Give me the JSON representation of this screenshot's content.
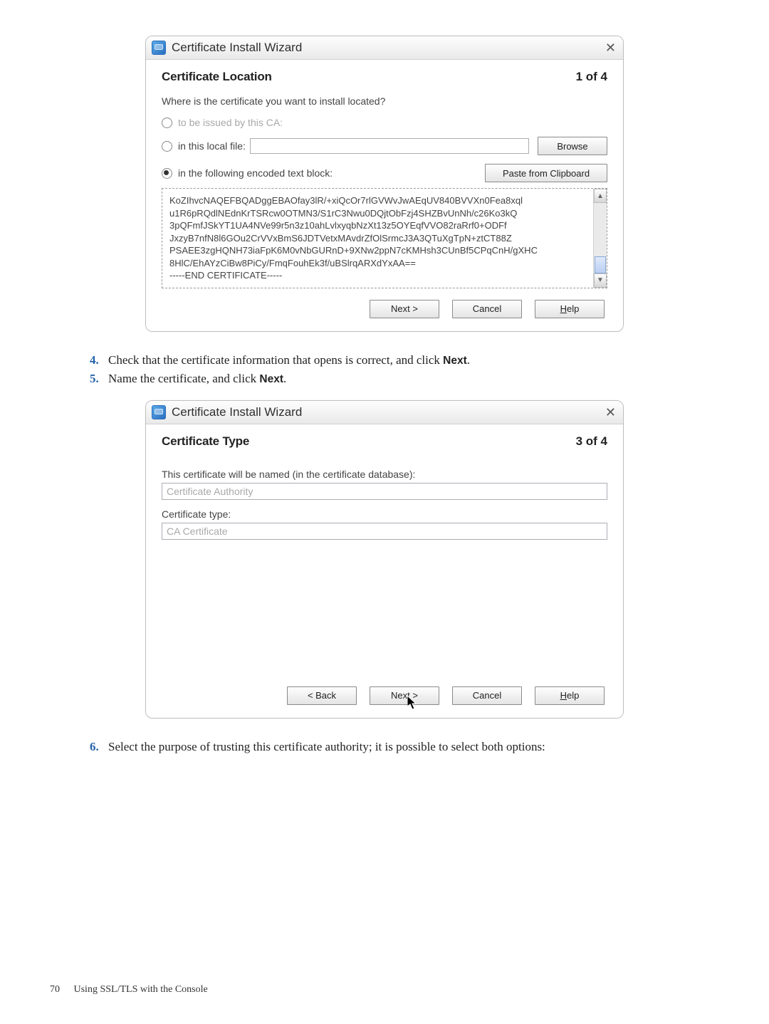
{
  "wizard1": {
    "window_title": "Certificate Install Wizard",
    "close_glyph": "✕",
    "heading": "Certificate Location",
    "step": "1 of 4",
    "prompt": "Where is the certificate you want to install located?",
    "opt_ca": "to be issued by this CA:",
    "opt_file": "in this local file:",
    "browse": "Browse",
    "opt_block": "in the following encoded text block:",
    "paste": "Paste from Clipboard",
    "encoded": "KoZIhvcNAQEFBQADggEBAOfay3lR/+xiQcOr7rlGVWvJwAEqUV840BVVXn0Fea8xql\nu1R6pRQdlNEdnKrTSRcw0OTMN3/S1rC3Nwu0DQjtObFzj4SHZBvUnNh/c26Ko3kQ\n3pQFmfJSkYT1UA4NVe99r5n3z10ahLvlxyqbNzXt13z5OYEqfVVO82raRrf0+ODFf\nJxzyB7nfN8l6GOu2CrVVxBmS6JDTVetxMAvdrZfOlSrmcJ3A3QTuXgTpN+ztCT88Z\nPSAEE3zgHQNH73iaFpK6M0vNbGURnD+9XNw2ppN7cKMHsh3CUnBf5CPqCnH/gXHC\n8HlC/EhAYzCiBw8PiCy/FmqFouhEk3f/uBSlrqARXdYxAA==\n-----END CERTIFICATE-----",
    "next": "Next >",
    "cancel": "Cancel",
    "help_pre": "H",
    "help_post": "elp"
  },
  "steps": {
    "s4_num": "4.",
    "s4_text_a": "Check that the certificate information that opens is correct, and click ",
    "s4_bold": "Next",
    "s4_text_b": ".",
    "s5_num": "5.",
    "s5_text_a": "Name the certificate, and click ",
    "s5_bold": "Next",
    "s5_text_b": ".",
    "s6_num": "6.",
    "s6_text": "Select the purpose of trusting this certificate authority; it is possible to select both options:"
  },
  "wizard2": {
    "window_title": "Certificate Install Wizard",
    "close_glyph": "✕",
    "heading": "Certificate Type",
    "step": "3 of 4",
    "name_label": "This certificate will be named (in the certificate database):",
    "name_value": "Certificate Authority",
    "type_label": "Certificate type:",
    "type_value": "CA Certificate",
    "back": "< Back",
    "next": "Next >",
    "cancel": "Cancel",
    "help_pre": "H",
    "help_post": "elp"
  },
  "footer": {
    "page": "70",
    "section": "Using SSL/TLS with the Console"
  }
}
